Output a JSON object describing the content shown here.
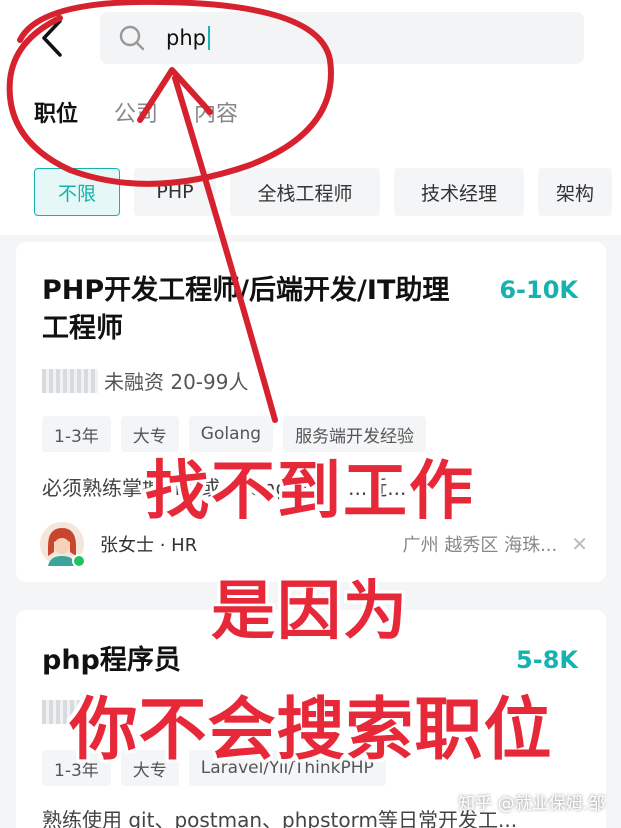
{
  "search": {
    "query": "php"
  },
  "tabs": [
    {
      "label": "职位",
      "active": true
    },
    {
      "label": "公司",
      "active": false
    },
    {
      "label": "内容",
      "active": false
    }
  ],
  "filters": [
    {
      "label": "不限",
      "selected": true
    },
    {
      "label": "PHP",
      "selected": false
    },
    {
      "label": "全栈工程师",
      "selected": false
    },
    {
      "label": "技术经理",
      "selected": false
    },
    {
      "label": "架构",
      "selected": false
    }
  ],
  "jobs": [
    {
      "title": "PHP开发工程师/后端开发/IT助理工程师",
      "salary": "6-10K",
      "company_info": "未融资  20-99人",
      "tags": [
        "1-3年",
        "大专",
        "Golang",
        "服务端开发经验"
      ],
      "description": "必须熟练掌握php或golang语言，...近...",
      "hr": "张女士 · HR",
      "location": "广州  越秀区  海珠..."
    },
    {
      "title": "php程序员",
      "salary": "5-8K",
      "tags": [
        "1-3年",
        "大专",
        "Laravel/Yii/ThinkPHP"
      ],
      "description": "熟练使用 git、postman、phpstorm等日常开发工..."
    }
  ],
  "overlay": {
    "line1": "找不到工作",
    "line2": "是因为",
    "line3": "你不会搜索职位"
  },
  "watermark": "知乎 @就业保姆.邹",
  "colors": {
    "accent": "#16b2b2",
    "annotation_red": "#e62838"
  }
}
